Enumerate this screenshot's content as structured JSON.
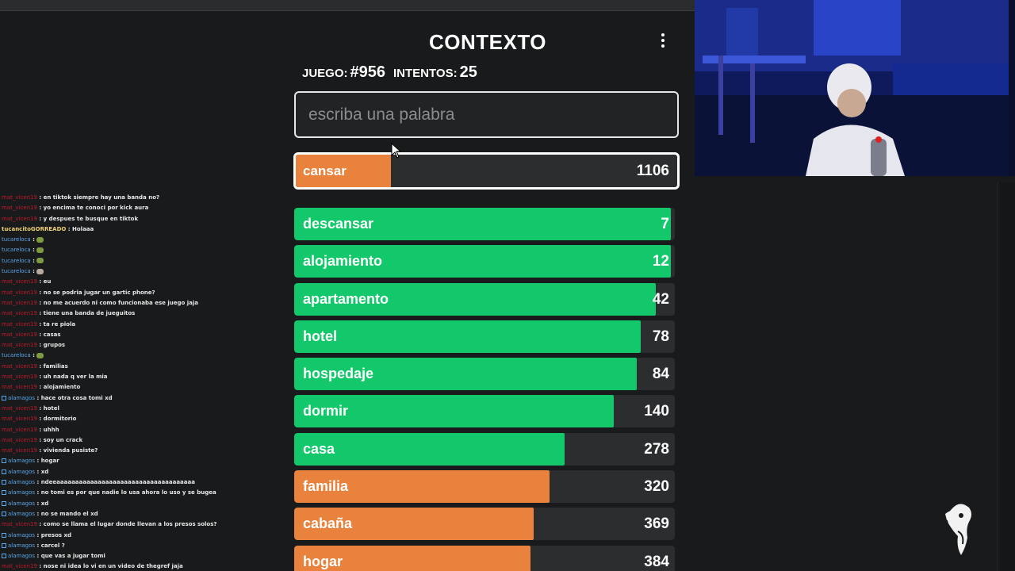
{
  "game": {
    "title": "CONTEXTO",
    "game_label": "JUEGO:",
    "game_number": "#956",
    "attempts_label": "INTENTOS:",
    "attempts": "25",
    "search_placeholder": "escriba una palabra",
    "current_guess": {
      "word": "cansar",
      "rank": "1106",
      "fill_fraction": 0.25
    },
    "guesses": [
      {
        "word": "descansar",
        "rank": "7",
        "color": "green",
        "fill_fraction": 0.99
      },
      {
        "word": "alojamiento",
        "rank": "12",
        "color": "green",
        "fill_fraction": 0.99
      },
      {
        "word": "apartamento",
        "rank": "42",
        "color": "green",
        "fill_fraction": 0.95
      },
      {
        "word": "hotel",
        "rank": "78",
        "color": "green",
        "fill_fraction": 0.91
      },
      {
        "word": "hospedaje",
        "rank": "84",
        "color": "green",
        "fill_fraction": 0.9
      },
      {
        "word": "dormir",
        "rank": "140",
        "color": "green",
        "fill_fraction": 0.84
      },
      {
        "word": "casa",
        "rank": "278",
        "color": "green",
        "fill_fraction": 0.71
      },
      {
        "word": "familia",
        "rank": "320",
        "color": "orange",
        "fill_fraction": 0.67
      },
      {
        "word": "cabaña",
        "rank": "369",
        "color": "orange",
        "fill_fraction": 0.63
      },
      {
        "word": "hogar",
        "rank": "384",
        "color": "orange",
        "fill_fraction": 0.62
      }
    ]
  },
  "colors": {
    "green": "#12c86a",
    "orange": "#e8823c",
    "background": "#181a1b",
    "row_bg": "#2b2d2f"
  },
  "chat": [
    {
      "user": "mat_vicen19",
      "user_color": "red",
      "msg": ": en tiktok siempre hay una banda no?"
    },
    {
      "user": "mat_vicen19",
      "user_color": "red",
      "msg": ": yo encima te conoci por kick aura"
    },
    {
      "user": "mat_vicen19",
      "user_color": "red",
      "msg": ": y despues te busque en tiktok"
    },
    {
      "user": "tucancitoGORREADO",
      "user_color": "gold",
      "msg": ": Holaaa"
    },
    {
      "user": "tucareloca",
      "user_color": "blue",
      "msg": ":",
      "emote": "green"
    },
    {
      "user": "tucareloca",
      "user_color": "blue",
      "msg": ":",
      "emote": "green"
    },
    {
      "user": "tucareloca",
      "user_color": "blue",
      "msg": ":",
      "emote": "green"
    },
    {
      "user": "tucareloca",
      "user_color": "blue",
      "msg": ":",
      "emote": "grey"
    },
    {
      "user": "mat_vicen19",
      "user_color": "red",
      "msg": ": eu"
    },
    {
      "user": "mat_vicen19",
      "user_color": "red",
      "msg": ": no se podria jugar un gartic phone?"
    },
    {
      "user": "mat_vicen19",
      "user_color": "red",
      "msg": ": no me acuerdo ni como funcionaba ese juego jaja"
    },
    {
      "user": "mat_vicen19",
      "user_color": "red",
      "msg": ": tiene una banda de jueguitos"
    },
    {
      "user": "mat_vicen19",
      "user_color": "red",
      "msg": ": ta re piola"
    },
    {
      "user": "mat_vicen19",
      "user_color": "red",
      "msg": ": casas"
    },
    {
      "user": "mat_vicen19",
      "user_color": "red",
      "msg": ": grupos"
    },
    {
      "user": "tucareloca",
      "user_color": "blue",
      "msg": ":",
      "emote": "green"
    },
    {
      "user": "mat_vicen19",
      "user_color": "red",
      "msg": ": familias"
    },
    {
      "user": "mat_vicen19",
      "user_color": "red",
      "msg": ": uh nada q ver la mia"
    },
    {
      "user": "mat_vicen19",
      "user_color": "red",
      "msg": ": alojamiento"
    },
    {
      "user": "alamagos",
      "user_color": "blue",
      "badge": true,
      "msg": ": hace otra cosa tomi xd"
    },
    {
      "user": "mat_vicen19",
      "user_color": "red",
      "msg": ": hotel"
    },
    {
      "user": "mat_vicen19",
      "user_color": "red",
      "msg": ": dormitorio"
    },
    {
      "user": "mat_vicen19",
      "user_color": "red",
      "msg": ": uhhh"
    },
    {
      "user": "mat_vicen19",
      "user_color": "red",
      "msg": ": soy un crack"
    },
    {
      "user": "mat_vicen19",
      "user_color": "red",
      "msg": ": vivienda pusiste?"
    },
    {
      "user": "alamagos",
      "user_color": "blue",
      "badge": true,
      "msg": ": hogar"
    },
    {
      "user": "alamagos",
      "user_color": "blue",
      "badge": true,
      "msg": ": xd"
    },
    {
      "user": "alamagos",
      "user_color": "blue",
      "badge": true,
      "msg": ": ndeeaaaaaaaaaaaaaaaaaaaaaaaaaaaaaaaaaaaaa"
    },
    {
      "user": "alamagos",
      "user_color": "blue",
      "badge": true,
      "msg": ": no tomi es por que nadie lo usa ahora lo uso y se bugea"
    },
    {
      "user": "alamagos",
      "user_color": "blue",
      "badge": true,
      "msg": ": xd"
    },
    {
      "user": "alamagos",
      "user_color": "blue",
      "badge": true,
      "msg": ": no se mando el xd"
    },
    {
      "user": "mat_vicen19",
      "user_color": "red",
      "msg": ": como se llama el lugar donde llevan a los presos solos?"
    },
    {
      "user": "alamagos",
      "user_color": "blue",
      "badge": true,
      "msg": ": presos xd"
    },
    {
      "user": "alamagos",
      "user_color": "blue",
      "badge": true,
      "msg": ": carcel ?"
    },
    {
      "user": "alamagos",
      "user_color": "blue",
      "badge": true,
      "msg": ": que vas a jugar tomi"
    },
    {
      "user": "mat_vicen19",
      "user_color": "red",
      "msg": ": nose ni idea lo vi en un video de thegref jaja"
    }
  ]
}
